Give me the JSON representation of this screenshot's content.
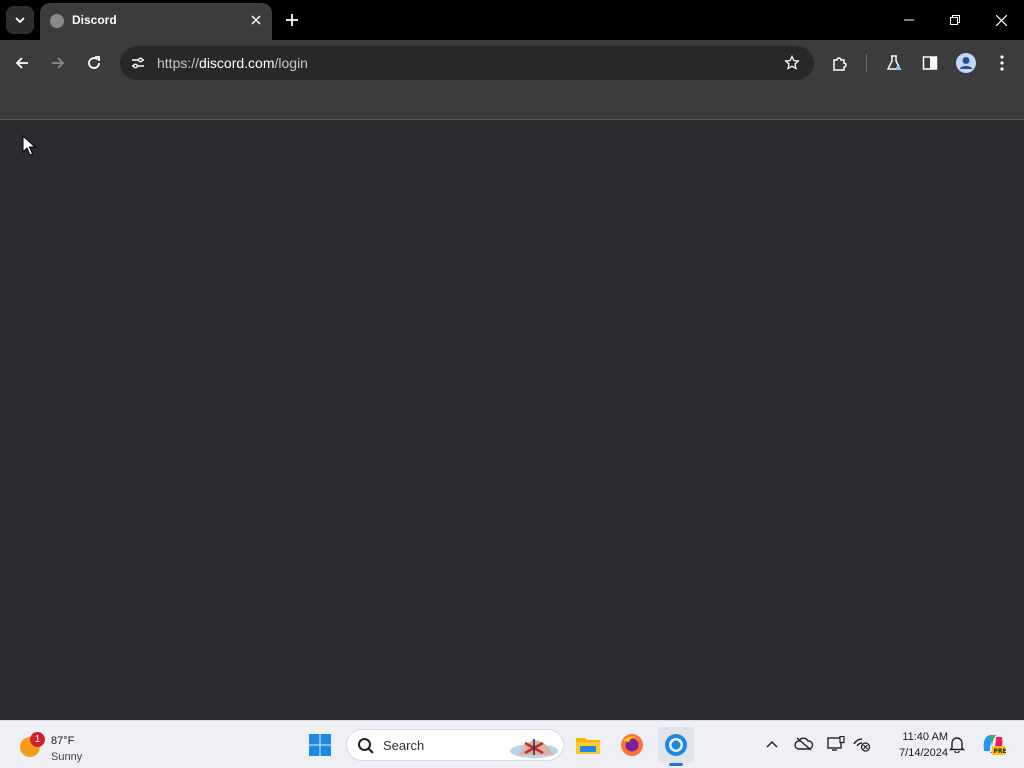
{
  "browser": {
    "tab": {
      "title": "Discord"
    },
    "url": {
      "host_prefix": "https://",
      "host": "discord.com",
      "path": "/login"
    }
  },
  "taskbar": {
    "weather": {
      "temperature": "87°F",
      "condition": "Sunny",
      "badge": "1"
    },
    "search": {
      "label": "Search"
    },
    "clock": {
      "time": "11:40 AM",
      "date": "7/14/2024"
    },
    "pinned_apps": [
      "start-menu",
      "file-explorer",
      "firefox",
      "chrome"
    ]
  },
  "colors": {
    "page_background": "#2b2b30",
    "toolbar": "#3c3c3c",
    "tabstrip": "#000000",
    "taskbar": "#eef0f5",
    "accent": "#1a73e8"
  }
}
